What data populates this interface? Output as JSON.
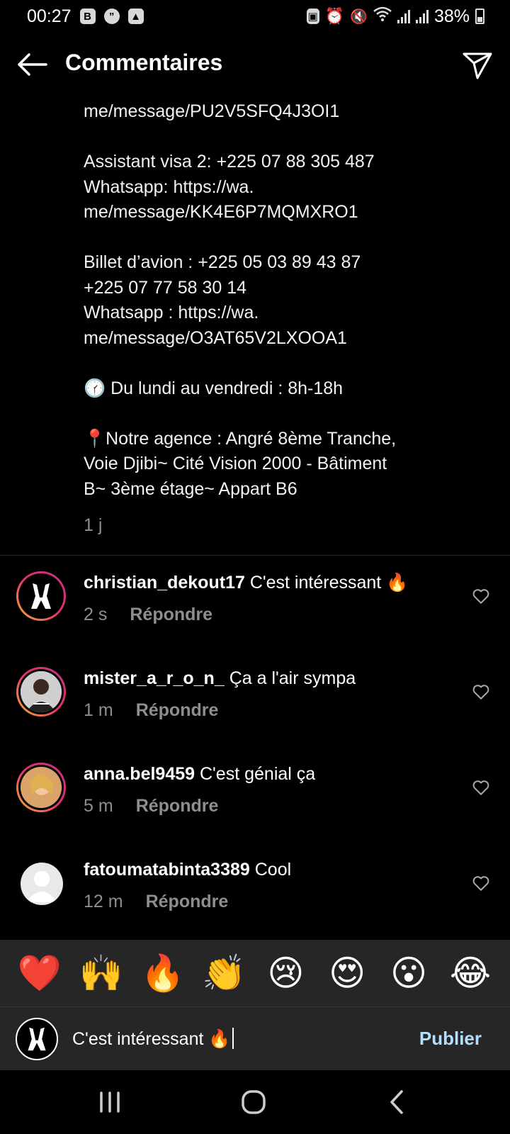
{
  "status_bar": {
    "time": "00:27",
    "battery": "38%"
  },
  "header": {
    "title": "Commentaires"
  },
  "post": {
    "lines": [
      "me/message/PU2V5SFQ4J3OI1",
      "",
      "Assistant visa 2: +225 07 88 305 487",
      "Whatsapp: https://wa.",
      "me/message/KK4E6P7MQMXRO1",
      "",
      "Billet d’avion : +225 05 03 89 43 87",
      "+225 07 77 58 30 14",
      "Whatsapp : https://wa.",
      "me/message/O3AT65V2LXOOA1",
      "",
      "🕜 Du lundi au vendredi : 8h-18h",
      "",
      "📍Notre agence : Angré 8ème Tranche,",
      "Voie Djibi~ Cité Vision 2000 - Bâtiment",
      "B~ 3ème étage~ Appart B6"
    ],
    "time": "1 j"
  },
  "comments": [
    {
      "username": "christian_dekout17",
      "text": "C'est intéressant 🔥",
      "time": "2 s",
      "reply_label": "Répondre"
    },
    {
      "username": "mister_a_r_o_n_",
      "text": "Ça a l'air sympa",
      "time": "1 m",
      "reply_label": "Répondre"
    },
    {
      "username": "anna.bel9459",
      "text": "C'est génial ça",
      "time": "5 m",
      "reply_label": "Répondre"
    },
    {
      "username": "fatoumatabinta3389",
      "text": "Cool",
      "time": "12 m",
      "reply_label": "Répondre"
    }
  ],
  "emoji_bar": {
    "emojis": [
      "❤️",
      "🙌",
      "🔥",
      "👏",
      "😢",
      "😍",
      "😮",
      "😂"
    ]
  },
  "composer": {
    "value": "C'est intéressant 🔥",
    "publish_label": "Publier"
  },
  "colors": {
    "background": "#000000",
    "publish": "#b2dffc",
    "muted": "#8e8e8e",
    "panel": "#262626"
  }
}
